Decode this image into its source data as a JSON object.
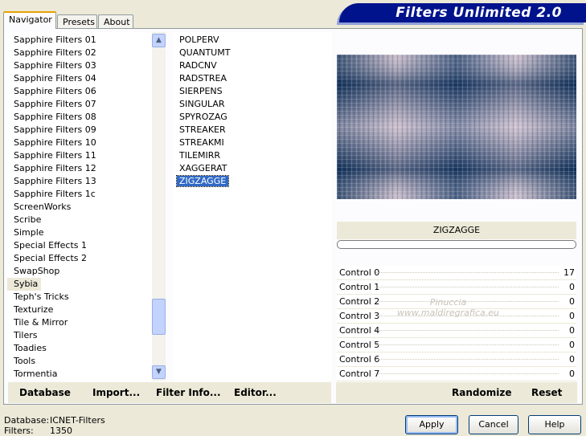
{
  "banner": {
    "title": "Filters Unlimited 2.0"
  },
  "tabs": [
    {
      "label": "Navigator"
    },
    {
      "label": "Presets"
    },
    {
      "label": "About"
    }
  ],
  "categories": [
    "Sapphire Filters 01",
    "Sapphire Filters 02",
    "Sapphire Filters 03",
    "Sapphire Filters 04",
    "Sapphire Filters 06",
    "Sapphire Filters 07",
    "Sapphire Filters 08",
    "Sapphire Filters 09",
    "Sapphire Filters 10",
    "Sapphire Filters 11",
    "Sapphire Filters 12",
    "Sapphire Filters 13",
    "Sapphire Filters 1c",
    "ScreenWorks",
    "Scribe",
    "Simple",
    "Special Effects 1",
    "Special Effects 2",
    "SwapShop",
    "Sybia",
    "Teph's Tricks",
    "Texturize",
    "Tile & Mirror",
    "Tilers",
    "Toadies",
    "Tools",
    "Tormentia"
  ],
  "selected_category": "Sybia",
  "filters": [
    "POLPERV",
    "QUANTUMT",
    "RADCNV",
    "RADSTREA",
    "SIERPENS",
    "SINGULAR",
    "SPYROZAG",
    "STREAKER",
    "STREAKMI",
    "TILEMIRR",
    "XAGGERAT",
    "ZIGZAGGE"
  ],
  "selected_filter": "ZIGZAGGE",
  "preview": {
    "filter_name": "ZIGZAGGE"
  },
  "controls": [
    {
      "label": "Control 0",
      "value": "17"
    },
    {
      "label": "Control 1",
      "value": "0"
    },
    {
      "label": "Control 2",
      "value": "0"
    },
    {
      "label": "Control 3",
      "value": "0"
    },
    {
      "label": "Control 4",
      "value": "0"
    },
    {
      "label": "Control 5",
      "value": "0"
    },
    {
      "label": "Control 6",
      "value": "0"
    },
    {
      "label": "Control 7",
      "value": "0"
    }
  ],
  "watermark": {
    "line1": "Pinuccia",
    "line2": "www.maldiregrafica.eu"
  },
  "left_buttons": {
    "database": "Database",
    "import": "Import...",
    "filter_info": "Filter Info...",
    "editor": "Editor..."
  },
  "right_buttons": {
    "randomize": "Randomize",
    "reset": "Reset"
  },
  "footer": {
    "database_label": "Database:",
    "database_value": "ICNET-Filters",
    "filters_label": "Filters:",
    "filters_value": "1350"
  },
  "dialog_buttons": {
    "apply": "Apply",
    "cancel": "Cancel",
    "help": "Help"
  },
  "colors": {
    "selection": "#316ac5",
    "banner": "#00138c",
    "window_bg": "#ece9d8"
  },
  "icons": {
    "scroll_up": "chevron-up-icon",
    "scroll_down": "chevron-down-icon"
  }
}
